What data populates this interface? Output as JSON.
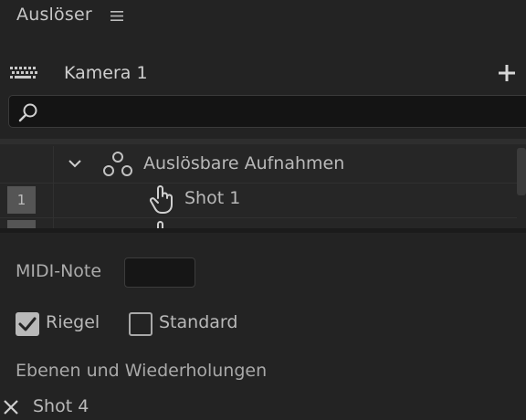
{
  "panel": {
    "title": "Auslöser",
    "menu_icon": "hamburger-menu-icon"
  },
  "camera": {
    "label": "Kamera 1",
    "left_icon": "keyboard-icon",
    "add_icon": "plus-icon"
  },
  "search": {
    "value": "",
    "placeholder": "",
    "icon": "search-icon"
  },
  "tree": {
    "group": {
      "label": "Auslösbare Aufnahmen",
      "expanded": true,
      "icon": "trigger-group-icon"
    },
    "items": [
      {
        "number": "1",
        "label": "Shot 1",
        "icon": "hand-pointer-icon"
      }
    ]
  },
  "properties": {
    "midi_label": "MIDI-Note",
    "midi_value": "",
    "checkboxes": [
      {
        "label": "Riegel",
        "checked": true
      },
      {
        "label": "Standard",
        "checked": false
      }
    ],
    "section_label": "Ebenen und Wiederholungen",
    "layer_item": {
      "label": "Shot 4",
      "icon": "close-icon"
    }
  },
  "colors": {
    "background": "#232323",
    "input_background": "#141414",
    "text": "#b9b9b9",
    "row_number_bg": "#555555"
  }
}
